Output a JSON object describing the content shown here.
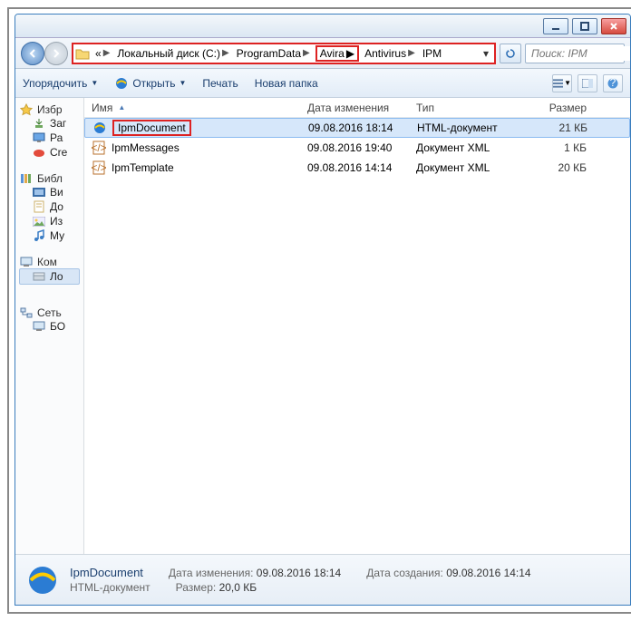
{
  "breadcrumb": {
    "overflow": "«",
    "items": [
      "Локальный диск (C:)",
      "ProgramData",
      "Avira",
      "Antivirus",
      "IPM"
    ]
  },
  "search": {
    "placeholder": "Поиск: IPM"
  },
  "toolbar": {
    "organize": "Упорядочить",
    "open": "Открыть",
    "print": "Печать",
    "newfolder": "Новая папка"
  },
  "columns": {
    "name": "Имя",
    "date": "Дата изменения",
    "type": "Тип",
    "size": "Размер"
  },
  "sidebar": {
    "favorites": {
      "label": "Избр",
      "items": [
        "Заг",
        "Ра",
        "Cre"
      ]
    },
    "libraries": {
      "label": "Библ",
      "items": [
        "Ви",
        "До",
        "Из",
        "Му"
      ]
    },
    "computer": {
      "label": "Ком",
      "items": [
        "Ло"
      ]
    },
    "network": {
      "label": "Сеть",
      "items": [
        "БО"
      ]
    }
  },
  "files": [
    {
      "name": "IpmDocument",
      "date": "09.08.2016 18:14",
      "type": "HTML-документ",
      "size": "21 КБ",
      "icon": "ie",
      "selected": true,
      "highlight": true
    },
    {
      "name": "IpmMessages",
      "date": "09.08.2016 19:40",
      "type": "Документ XML",
      "size": "1 КБ",
      "icon": "xml",
      "selected": false,
      "highlight": false
    },
    {
      "name": "IpmTemplate",
      "date": "09.08.2016 14:14",
      "type": "Документ XML",
      "size": "20 КБ",
      "icon": "xml",
      "selected": false,
      "highlight": false
    }
  ],
  "details": {
    "name": "IpmDocument",
    "type": "HTML-документ",
    "modified_label": "Дата изменения:",
    "modified_value": "09.08.2016 18:14",
    "created_label": "Дата создания:",
    "created_value": "09.08.2016 14:14",
    "size_label": "Размер:",
    "size_value": "20,0 КБ"
  }
}
